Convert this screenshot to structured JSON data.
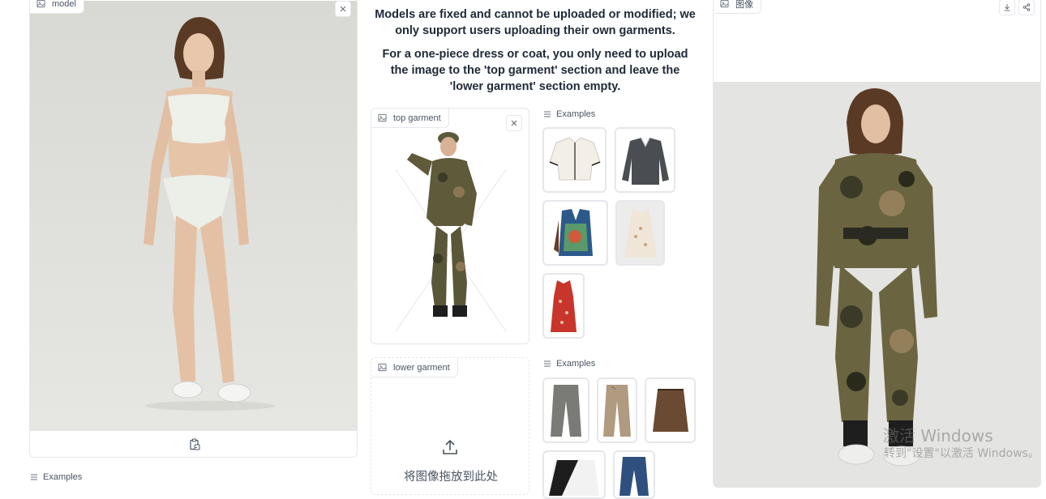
{
  "model_panel": {
    "label": "model",
    "examples_label": "Examples"
  },
  "instructions": {
    "line1": "Models are fixed and cannot be uploaded or modified; we only support users uploading their own garments.",
    "line2": "For a one-piece dress or coat, you only need to upload the image to the 'top garment' section and leave the 'lower garment' section empty."
  },
  "top_garment": {
    "label": "top garment",
    "examples_label": "Examples"
  },
  "lower_garment": {
    "label": "lower garment",
    "examples_label": "Examples",
    "drop_text": "将图像拖放到此处"
  },
  "output_panel": {
    "label": "图像"
  },
  "watermark": {
    "title": "激活 Windows",
    "subtitle": "转到\"设置\"以激活 Windows。"
  },
  "colors": {
    "border": "#e5e7eb",
    "label_text": "#4b5563",
    "photo_bg": "#dcdcd8"
  }
}
